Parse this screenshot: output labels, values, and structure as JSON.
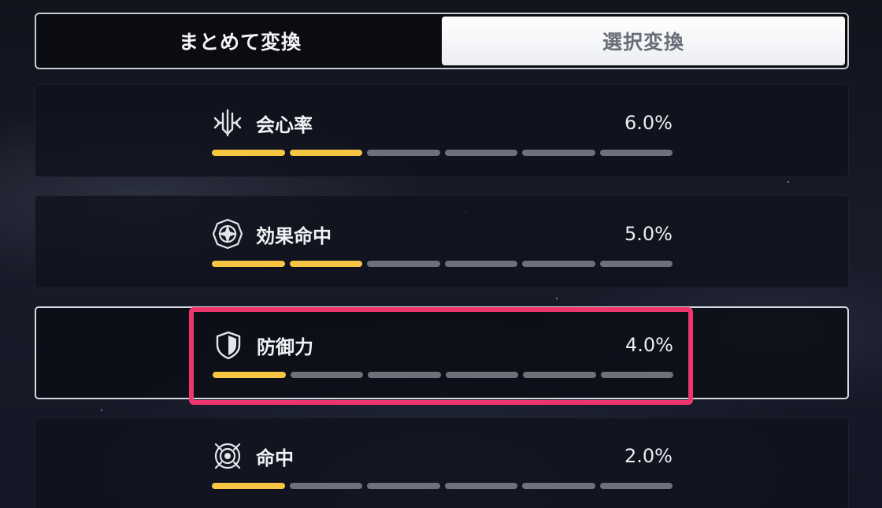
{
  "tabs": {
    "bulk_label": "まとめて変換",
    "select_label": "選択変換"
  },
  "stats": [
    {
      "label": "会心率",
      "value": "6.0%",
      "level": 2,
      "max_level": 6,
      "icon": "critical-rate-icon"
    },
    {
      "label": "効果命中",
      "value": "5.0%",
      "level": 2,
      "max_level": 6,
      "icon": "effect-hit-icon"
    },
    {
      "label": "防御力",
      "value": "4.0%",
      "level": 1,
      "max_level": 6,
      "icon": "shield-icon"
    },
    {
      "label": "命中",
      "value": "2.0%",
      "level": 1,
      "max_level": 6,
      "icon": "target-icon"
    }
  ],
  "colors": {
    "bar_active": "#f6c544",
    "bar_inactive": "#6f7079",
    "highlight": "#f0356e"
  }
}
